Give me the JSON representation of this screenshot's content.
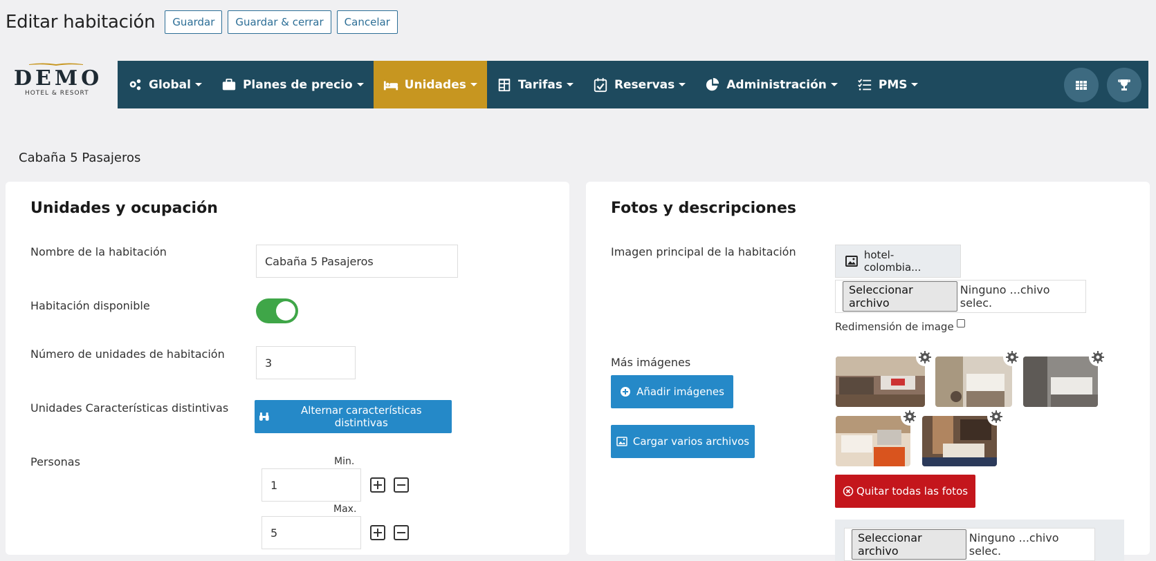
{
  "page": {
    "title": "Editar habitación",
    "buttons": {
      "save": "Guardar",
      "save_close": "Guardar & cerrar",
      "cancel": "Cancelar"
    }
  },
  "logo": {
    "word": "DEMO",
    "subtitle": "HOTEL & RESORT"
  },
  "nav": {
    "items": [
      {
        "label": "Global",
        "icon": "gears-icon"
      },
      {
        "label": "Planes de precio",
        "icon": "briefcase-icon"
      },
      {
        "label": "Unidades",
        "icon": "bed-icon",
        "active": true
      },
      {
        "label": "Tarifas",
        "icon": "table-icon"
      },
      {
        "label": "Reservas",
        "icon": "calendar-check-icon"
      },
      {
        "label": "Administración",
        "icon": "pie-chart-icon"
      },
      {
        "label": "PMS",
        "icon": "list-check-icon"
      }
    ],
    "right_buttons": [
      "grid-icon",
      "trophy-icon"
    ],
    "colors": {
      "bar": "#1e4a5e",
      "active": "#c79620"
    }
  },
  "room_subtitle": "Cabaña 5 Pasajeros",
  "left_card": {
    "title": "Unidades y ocupación",
    "room_name_label": "Nombre de la habitación",
    "room_name_value": "Cabaña 5 Pasajeros",
    "available_label": "Habitación disponible",
    "available": true,
    "units_label": "Número de unidades de habitación",
    "units_value": "3",
    "features_label": "Unidades Características distintivas",
    "features_button": "Alternar características distintivas",
    "persons_label": "Personas",
    "min_label": "Min.",
    "min_value": "1",
    "max_label": "Max.",
    "max_value": "5"
  },
  "right_card": {
    "title": "Fotos y descripciones",
    "main_image_label": "Imagen principal de la habitación",
    "main_image_file": "hotel-colombia...",
    "file_button": "Seleccionar archivo",
    "file_none": "Ninguno ...chivo selec.",
    "resize_label": "Redimensión de image",
    "more_images_label": "Más imágenes",
    "add_images_button": "Añadir imágenes",
    "upload_multiple_button": "Cargar varios archivos",
    "remove_all_button": "Quitar todas las fotos"
  },
  "colors": {
    "primary": "#2589c8",
    "danger": "#c4161c",
    "toggle_on": "#3fa648"
  }
}
